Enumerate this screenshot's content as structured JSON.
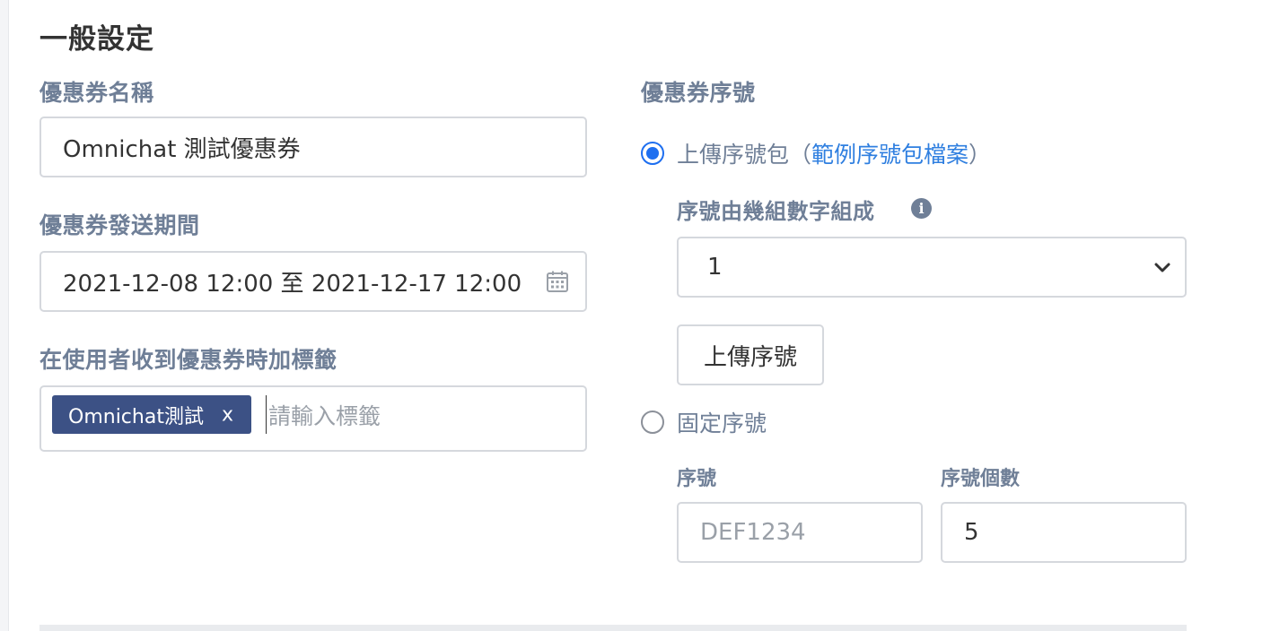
{
  "section_title": "一般設定",
  "coupon_name": {
    "label": "優惠券名稱",
    "value": "Omnichat 測試優惠券"
  },
  "send_period": {
    "label": "優惠券發送期間",
    "value": "2021-12-08 12:00 至 2021-12-17 12:00",
    "icon": "calendar-icon"
  },
  "tags": {
    "label": "在使用者收到優惠券時加標籤",
    "chips": [
      {
        "label": "Omnichat測試",
        "remove": "x"
      }
    ],
    "placeholder": "請輸入標籤"
  },
  "serial": {
    "label": "優惠券序號",
    "upload_option": {
      "label": "上傳序號包（",
      "link": "範例序號包檔案",
      "suffix": "）",
      "checked": true
    },
    "groups_label": "序號由幾組數字組成",
    "groups_icon": "info-icon",
    "groups_select_value": "1",
    "upload_button": "上傳序號",
    "fixed_option": {
      "label": "固定序號",
      "checked": false
    },
    "fixed_serial_label": "序號",
    "fixed_serial_placeholder": "DEF1234",
    "fixed_count_label": "序號個數",
    "fixed_count_value": "5"
  },
  "colors": {
    "label": "#6f7f97",
    "chip_bg": "#3c5185",
    "accent": "#1e6ff0",
    "link": "#2f7fe0"
  }
}
